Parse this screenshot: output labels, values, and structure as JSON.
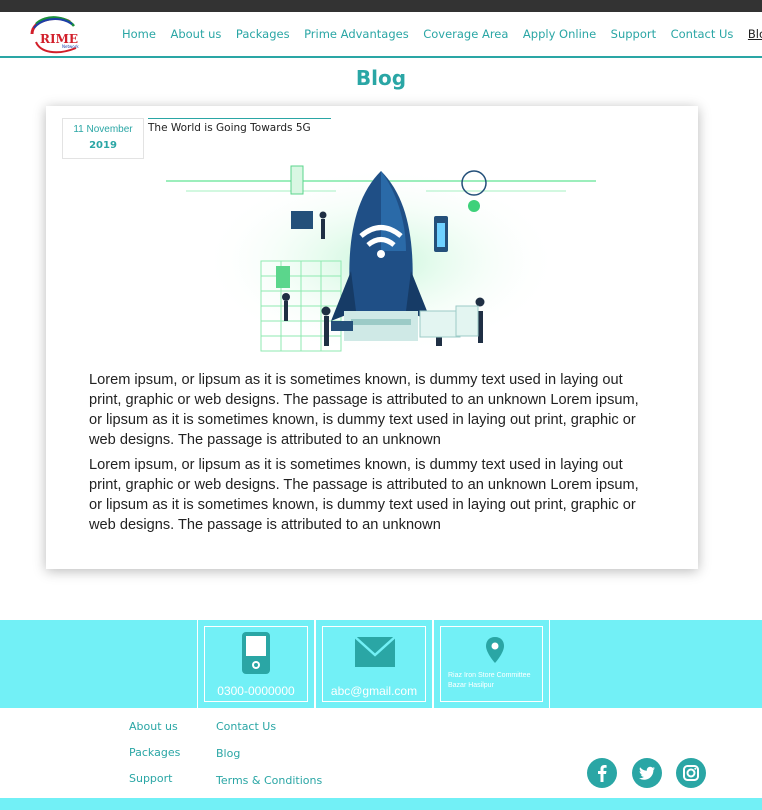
{
  "brand": {
    "logo_text": "RIME",
    "logo_sub": "Network",
    "logo_icon": "prime-network-logo"
  },
  "nav": {
    "items": [
      {
        "label": "Home"
      },
      {
        "label": "About us"
      },
      {
        "label": "Packages"
      },
      {
        "label": "Prime Advantages"
      },
      {
        "label": "Coverage Area"
      },
      {
        "label": "Apply Online"
      },
      {
        "label": "Support"
      },
      {
        "label": "Contact Us"
      },
      {
        "label": "Blog",
        "active": true
      }
    ]
  },
  "page": {
    "title": "Blog"
  },
  "post": {
    "date_day_month": "11 November",
    "date_year": "2019",
    "title": "The World is Going Towards 5G",
    "image_icon": "rocket-wifi-illustration",
    "paragraphs": [
      "Lorem ipsum, or lipsum as it is sometimes known, is dummy text used in laying out print, graphic or web designs. The passage is attributed to an unknown Lorem ipsum, or lipsum as it is sometimes known, is dummy text used in laying out print, graphic or web designs. The passage is attributed to an unknown",
      "Lorem ipsum, or lipsum as it is sometimes known, is dummy text used in laying out print, graphic or web designs. The passage is attributed to an unknown Lorem ipsum, or lipsum as it is sometimes known, is dummy text used in laying out print, graphic or web designs. The passage is attributed to an unknown"
    ]
  },
  "contact": {
    "phone": "0300-0000000",
    "phone_icon": "phone-icon",
    "email": "abc@gmail.com",
    "email_icon": "mail-icon",
    "address_line1": "Riaz Iron Store Committee",
    "address_line2": "Bazar Hasilpur",
    "address_icon": "location-pin-icon"
  },
  "footer_links": {
    "about": "About us",
    "packages": "Packages",
    "support": "Support",
    "contact": "Contact Us",
    "blog": "Blog",
    "terms": "Terms & Conditions"
  },
  "social": [
    "facebook-icon",
    "twitter-icon",
    "instagram-icon"
  ],
  "colors": {
    "accent": "#2aa6a5",
    "footer_band": "#72f0f6",
    "topbar": "#333333"
  }
}
